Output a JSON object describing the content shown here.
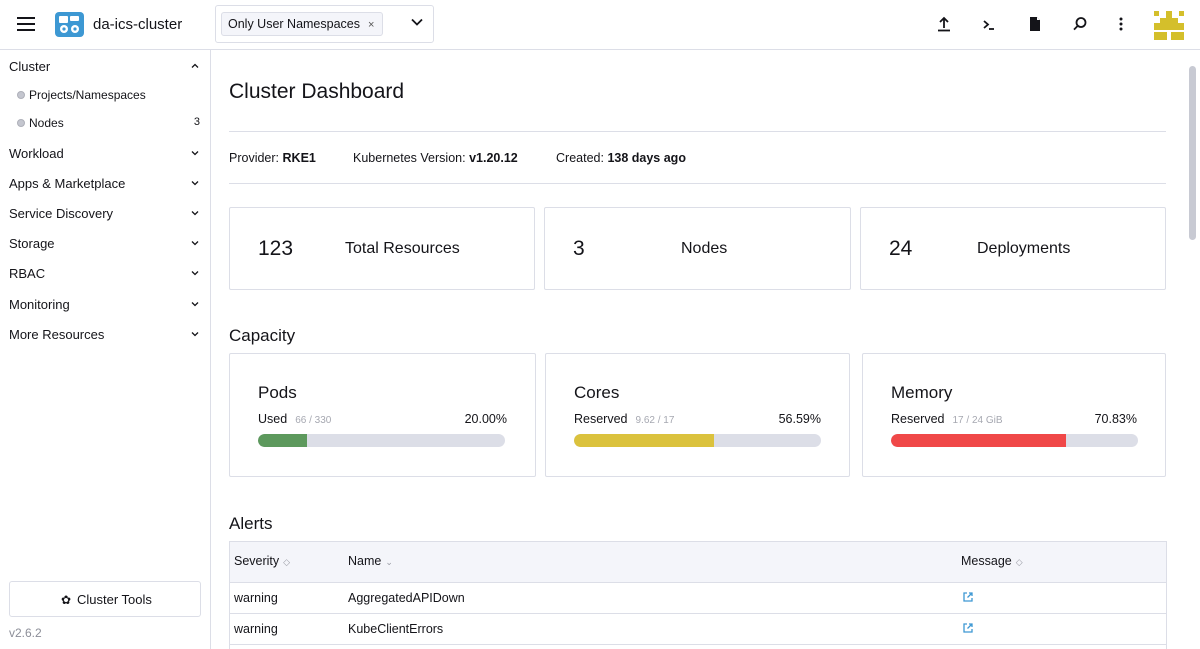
{
  "header": {
    "cluster_name": "da-ics-cluster",
    "namespace_chip": "Only User Namespaces",
    "namespace_chip_remove": "×",
    "icons": [
      "upload-icon",
      "shell-icon",
      "file-icon",
      "search-icon",
      "more-vert-icon",
      "user-avatar"
    ]
  },
  "sidebar": {
    "groups": [
      {
        "label": "Cluster",
        "expanded": true
      },
      {
        "label": "Workload"
      },
      {
        "label": "Apps & Marketplace"
      },
      {
        "label": "Service Discovery"
      },
      {
        "label": "Storage"
      },
      {
        "label": "RBAC"
      },
      {
        "label": "Monitoring"
      },
      {
        "label": "More Resources"
      }
    ],
    "cluster_items": [
      {
        "label": "Projects/Namespaces",
        "count": ""
      },
      {
        "label": "Nodes",
        "count": "3"
      }
    ],
    "tools_label": "Cluster Tools",
    "version": "v2.6.2"
  },
  "main": {
    "title": "Cluster Dashboard",
    "meta": {
      "provider_label": "Provider:",
      "provider_value": "RKE1",
      "k8s_label": "Kubernetes Version:",
      "k8s_value": "v1.20.12",
      "created_label": "Created:",
      "created_value": "138 days ago"
    },
    "stats": [
      {
        "value": "123",
        "label": "Total Resources"
      },
      {
        "value": "3",
        "label": "Nodes"
      },
      {
        "value": "24",
        "label": "Deployments"
      }
    ],
    "capacity_title": "Capacity",
    "capacity": [
      {
        "title": "Pods",
        "sub_label": "Used",
        "detail": "66 / 330",
        "percent_text": "20.00%",
        "fraction": 0.2,
        "color": "#5d995d"
      },
      {
        "title": "Cores",
        "sub_label": "Reserved",
        "detail": "9.62 / 17",
        "percent_text": "56.59%",
        "fraction": 0.5659,
        "color": "#dbc23d"
      },
      {
        "title": "Memory",
        "sub_label": "Reserved",
        "detail": "17 / 24 GiB",
        "percent_text": "70.83%",
        "fraction": 0.7083,
        "color": "#f04848"
      }
    ],
    "alerts_title": "Alerts",
    "alerts_table": {
      "columns": [
        "Severity",
        "Name",
        "Message"
      ],
      "rows": [
        {
          "severity": "warning",
          "name": "AggregatedAPIDown"
        },
        {
          "severity": "warning",
          "name": "KubeClientErrors"
        }
      ]
    }
  },
  "colors": {
    "accent": "#3d98d3",
    "border": "#dcdee7",
    "link": "#3d98d3"
  }
}
